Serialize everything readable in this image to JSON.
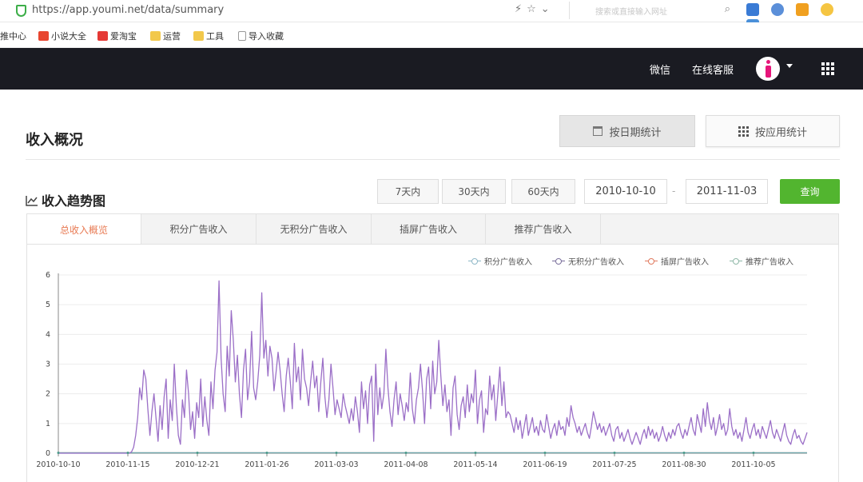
{
  "browser": {
    "url": "https://app.youmi.net/data/summary",
    "search_placeholder": "搜索或直接输入网址",
    "bookmarks": [
      "推中心",
      "小说大全",
      "爱淘宝",
      "运营",
      "工具",
      "导入收藏"
    ]
  },
  "navbar": {
    "links": [
      "微信",
      "在线客服"
    ]
  },
  "page": {
    "title": "收入概况",
    "btn_by_date": "按日期统计",
    "btn_by_app": "按应用统计"
  },
  "trend": {
    "title": "收入趋势图",
    "ranges": [
      "7天内",
      "30天内",
      "60天内"
    ],
    "date_from": "2010-10-10",
    "date_to": "2011-11-03",
    "date_sep": "-",
    "query": "查询"
  },
  "tabs": [
    {
      "label": "总收入概览",
      "active": true
    },
    {
      "label": "积分广告收入",
      "active": false
    },
    {
      "label": "无积分广告收入",
      "active": false
    },
    {
      "label": "插屏广告收入",
      "active": false
    },
    {
      "label": "推荐广告收入",
      "active": false
    }
  ],
  "colors": {
    "accent_green": "#52b52f",
    "active_tab": "#e87a53",
    "navbar": "#1a1b22",
    "series_purple": "#9b6fc7"
  },
  "chart_data": {
    "type": "line",
    "ylim": [
      0,
      6
    ],
    "yticks": [
      "0",
      "1",
      "2",
      "3",
      "4",
      "5",
      "6"
    ],
    "xticks": [
      "2010-10-10",
      "2010-11-15",
      "2010-12-21",
      "2011-01-26",
      "2011-03-03",
      "2011-04-08",
      "2011-05-14",
      "2011-06-19",
      "2011-07-25",
      "2011-08-30",
      "2011-10-05"
    ],
    "legend": [
      {
        "name": "积分广告收入",
        "color": "#8fb8c8"
      },
      {
        "name": "无积分广告收入",
        "color": "#7a6f9b"
      },
      {
        "name": "插屏广告收入",
        "color": "#e07a5f"
      },
      {
        "name": "推荐广告收入",
        "color": "#8fb8a8"
      }
    ],
    "grid": true,
    "series": [
      {
        "name": "积分广告收入",
        "color": "#9b6fc7",
        "values": [
          0,
          0,
          0,
          0,
          0,
          0,
          0,
          0,
          0,
          0,
          0,
          0,
          0,
          0,
          0,
          0,
          0,
          0,
          0,
          0,
          0,
          0,
          0,
          0,
          0,
          0,
          0,
          0,
          0,
          0,
          0,
          0,
          0,
          0,
          0,
          0,
          0.05,
          0.2,
          0.6,
          1.2,
          2.2,
          1.8,
          2.8,
          2.5,
          1.5,
          0.6,
          1.4,
          2.0,
          1.2,
          0.4,
          1.6,
          0.8,
          1.9,
          2.5,
          0.5,
          1.8,
          1.1,
          3.0,
          1.6,
          0.6,
          0.3,
          1.8,
          1.2,
          2.8,
          2.0,
          0.8,
          1.4,
          0.5,
          1.7,
          1.2,
          2.5,
          0.9,
          1.9,
          1.1,
          0.6,
          2.4,
          1.5,
          2.8,
          3.4,
          5.8,
          3.2,
          2.0,
          1.4,
          3.6,
          2.6,
          4.8,
          3.8,
          2.4,
          3.3,
          2.0,
          1.2,
          2.8,
          3.5,
          1.8,
          2.4,
          4.1,
          2.2,
          1.8,
          2.4,
          3.3,
          5.4,
          3.2,
          3.8,
          2.6,
          3.6,
          3.2,
          2.1,
          2.7,
          3.4,
          2.8,
          2.0,
          1.4,
          2.6,
          3.2,
          2.4,
          1.5,
          3.7,
          2.4,
          2.9,
          1.8,
          3.5,
          2.5,
          2.2,
          1.6,
          2.4,
          3.1,
          2.2,
          2.6,
          1.4,
          2.4,
          3.2,
          1.9,
          1.2,
          1.8,
          3.0,
          2.2,
          1.3,
          1.8,
          1.5,
          1.2,
          2.0,
          1.6,
          1.3,
          1.0,
          1.5,
          1.1,
          1.9,
          1.4,
          0.7,
          2.4,
          1.5,
          2.1,
          1.0,
          2.3,
          2.6,
          0.4,
          3.0,
          1.3,
          2.2,
          1.5,
          2.0,
          3.5,
          2.2,
          1.4,
          0.9,
          1.8,
          2.4,
          1.3,
          2.0,
          1.6,
          1.1,
          1.7,
          1.4,
          2.7,
          1.5,
          1.0,
          1.8,
          2.2,
          3.0,
          2.1,
          1.0,
          2.5,
          2.9,
          1.5,
          3.1,
          2.0,
          2.4,
          3.8,
          2.6,
          1.6,
          2.3,
          1.4,
          1.8,
          0.6,
          2.2,
          2.6,
          1.3,
          0.8,
          1.6,
          1.9,
          1.2,
          2.3,
          1.4,
          2.0,
          1.7,
          2.8,
          1.0,
          1.8,
          2.1,
          0.7,
          1.5,
          1.3,
          2.6,
          1.8,
          2.3,
          1.1,
          2.0,
          2.9,
          1.6,
          2.4,
          1.2,
          1.4,
          1.3,
          1.0,
          0.7,
          1.2,
          0.8,
          1.1,
          0.5,
          0.9,
          1.3,
          0.6,
          0.9,
          1.2,
          0.7,
          0.9,
          0.6,
          1.1,
          0.8,
          0.7,
          1.3,
          0.9,
          0.5,
          0.8,
          1.0,
          0.6,
          1.1,
          0.8,
          0.9,
          0.6,
          1.2,
          0.9,
          1.6,
          1.2,
          1.0,
          0.7,
          0.9,
          0.6,
          0.8,
          1.0,
          0.7,
          0.5,
          0.9,
          1.4,
          1.1,
          0.8,
          1.0,
          0.7,
          0.9,
          0.6,
          0.8,
          1.0,
          0.6,
          0.4,
          0.8,
          0.9,
          0.5,
          0.7,
          0.4,
          0.6,
          0.8,
          0.5,
          0.3,
          0.5,
          0.7,
          0.5,
          0.3,
          0.6,
          0.8,
          0.5,
          0.9,
          0.6,
          0.8,
          0.5,
          0.7,
          0.4,
          0.6,
          0.9,
          0.6,
          0.4,
          0.7,
          0.5,
          0.8,
          0.6,
          0.9,
          1.0,
          0.7,
          0.5,
          0.8,
          0.6,
          0.9,
          1.2,
          0.8,
          0.6,
          1.3,
          1.0,
          0.7,
          1.5,
          0.9,
          1.7,
          1.1,
          0.8,
          1.2,
          0.6,
          0.9,
          1.3,
          0.8,
          1.0,
          0.6,
          0.8,
          1.5,
          0.9,
          0.6,
          0.8,
          0.5,
          0.7,
          0.4,
          0.8,
          1.2,
          0.7,
          0.5,
          0.8,
          1.0,
          0.6,
          0.8,
          0.5,
          0.9,
          0.7,
          0.5,
          0.8,
          1.1,
          0.7,
          0.5,
          0.8,
          0.6,
          0.4,
          0.7,
          1.0,
          0.6,
          0.4,
          0.3,
          0.6,
          0.8,
          0.5,
          0.6,
          0.4,
          0.3,
          0.5,
          0.7
        ]
      },
      {
        "name": "无积分广告收入",
        "color": "#4a9a8a",
        "values": [
          0
        ]
      },
      {
        "name": "插屏广告收入",
        "color": "#e07a5f",
        "values": [
          0
        ]
      },
      {
        "name": "推荐广告收入",
        "color": "#6aa7b0",
        "values": [
          0
        ]
      }
    ]
  }
}
